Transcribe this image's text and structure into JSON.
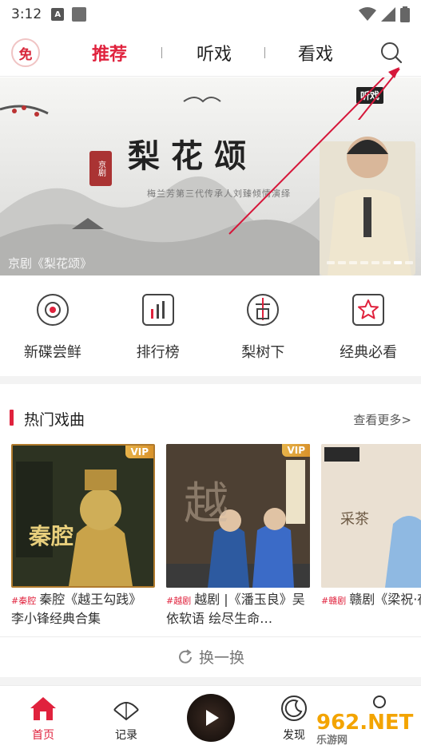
{
  "status_bar": {
    "time": "3:12",
    "mini_a": "A"
  },
  "top_nav": {
    "free_badge": "免",
    "tabs": [
      {
        "label": "推荐",
        "active": true
      },
      {
        "label": "听戏",
        "active": false
      },
      {
        "label": "看戏",
        "active": false
      }
    ],
    "search_icon": "search-icon"
  },
  "banner": {
    "title": "梨花颂",
    "subtitle": "梅兰芳第三代传承人刘臻倾情演绎",
    "brand": "听戏",
    "stamp": "京剧",
    "caption": "京剧《梨花颂》",
    "total_slides": 8,
    "active_slide": 6
  },
  "quick_menu": [
    {
      "label": "新碟尝鲜",
      "icon": "disc-icon"
    },
    {
      "label": "排行榜",
      "icon": "chart-icon"
    },
    {
      "label": "梨树下",
      "icon": "tree-icon"
    },
    {
      "label": "经典必看",
      "icon": "star-icon"
    }
  ],
  "hot_section": {
    "title": "热门戏曲",
    "more": "查看更多>"
  },
  "cards": [
    {
      "tag": "#秦腔",
      "text": "秦腔《越王勾践》 李小锋经典合集",
      "vip": "VIP",
      "cover_text": "秦腔"
    },
    {
      "tag": "#越剧",
      "text": "越剧 |《潘玉良》吴依软语 绘尽生命…",
      "vip": "VIP",
      "cover_text": "越"
    },
    {
      "tag": "#赣剧",
      "text": "赣剧《梁祝·夜读》",
      "vip": "",
      "cover_text": "采茶"
    }
  ],
  "refresh_label": "换一换",
  "bottom_nav": [
    {
      "label": "首页",
      "active": true,
      "icon": "home-icon"
    },
    {
      "label": "记录",
      "active": false,
      "icon": "record-icon"
    },
    {
      "label": "发现",
      "active": false,
      "icon": "discover-icon"
    }
  ],
  "watermark": {
    "main": "962.NET",
    "sub": "乐游网"
  },
  "colors": {
    "accent": "#e0223d",
    "vip": "#e0a43c"
  }
}
